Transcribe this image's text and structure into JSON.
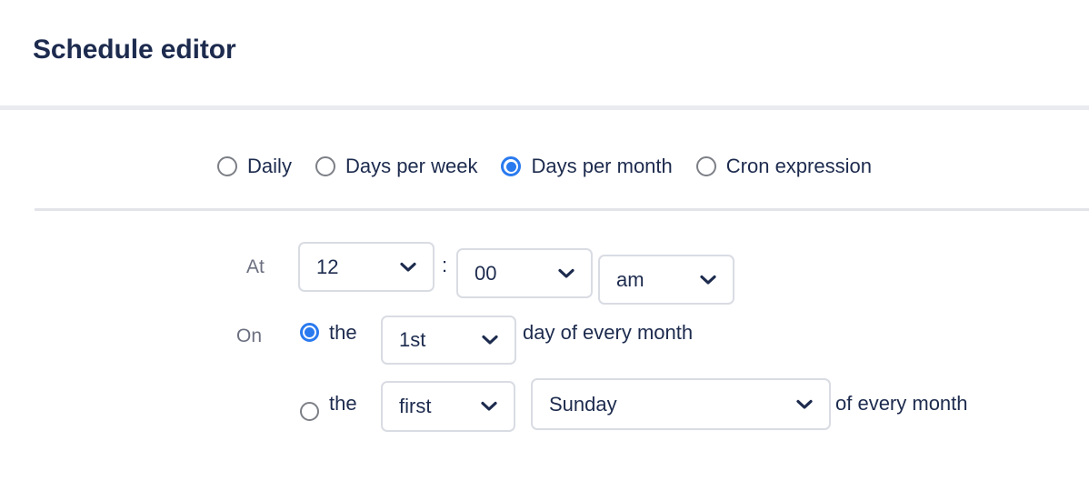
{
  "header": {
    "title": "Schedule editor"
  },
  "mode": {
    "options": [
      {
        "label": "Daily",
        "selected": false
      },
      {
        "label": "Days per week",
        "selected": false
      },
      {
        "label": "Days per month",
        "selected": true
      },
      {
        "label": "Cron expression",
        "selected": false
      }
    ]
  },
  "form": {
    "at_label": "At",
    "on_label": "On",
    "time_separator": ":",
    "hour": {
      "value": "12"
    },
    "minute": {
      "value": "00"
    },
    "meridiem": {
      "value": "am"
    },
    "day_of_month_option": {
      "selected": true,
      "the_label": "the",
      "day": {
        "value": "1st"
      },
      "trailing_text": "day of every month"
    },
    "nth_weekday_option": {
      "selected": false,
      "the_label": "the",
      "ordinal": {
        "value": "first"
      },
      "weekday": {
        "value": "Sunday"
      },
      "trailing_text": "of every month"
    }
  },
  "colors": {
    "title": "#1d2b4e",
    "accent": "#2a7aef",
    "label_muted": "#6c7080",
    "border": "#d9dce3",
    "divider": "#e9ebf0"
  },
  "icons": {
    "chevron_down": "chevron-down-icon",
    "radio": "radio-button-icon"
  }
}
